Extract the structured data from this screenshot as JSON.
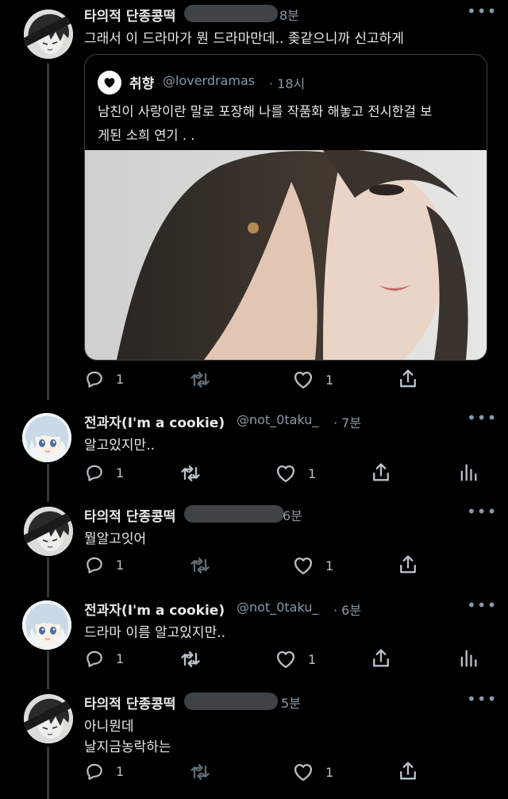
{
  "tweet1": {
    "name": "타의적 단종콩떡",
    "time": "8분",
    "text": "그래서 이 드라마가 뭔 드라마만데.. 좆같으니까 신고하게",
    "quoted": {
      "name": "취향",
      "handle": "@loverdramas",
      "time": "· 18시",
      "text_line1": "남친이 사랑이란 말로 포장해 나를 작품화 해놓고 전시한걸 보",
      "text_line2": "게된 소희 연기 . ."
    },
    "reply_count": "1",
    "like_count": "1"
  },
  "tweet2": {
    "name": "전과자(I'm a cookie)",
    "handle": "@not_0taku_",
    "time": "· 7분",
    "text": "알고있지만..",
    "reply_count": "1",
    "like_count": "1"
  },
  "tweet3": {
    "name": "타의적 단종콩떡",
    "time": "6분",
    "text": "뭘알고잇어",
    "reply_count": "1",
    "like_count": "1"
  },
  "tweet4": {
    "name": "전과자(I'm a cookie)",
    "handle": "@not_0taku_",
    "time": "· 6분",
    "text": "드라마 이름 알고있지만..",
    "reply_count": "1",
    "like_count": "1"
  },
  "tweet5": {
    "name": "타의적 단종콩떡",
    "time": "5분",
    "text_line1": "아니뭔데",
    "text_line2": "날지금농락하는",
    "reply_count": "1",
    "like_count": "1"
  },
  "icons": {
    "more": "ellipsis-icon",
    "reply": "speech-bubble-icon",
    "retweet": "retweet-icon",
    "like": "heart-icon",
    "share": "share-icon",
    "analytics": "bar-chart-icon"
  }
}
